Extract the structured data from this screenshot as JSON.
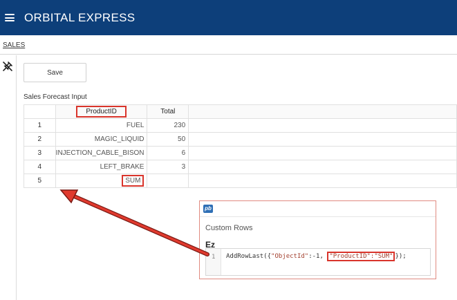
{
  "header": {
    "title": "ORBITAL EXPRESS"
  },
  "tabs": {
    "active": "SALES"
  },
  "toolbar": {
    "save_label": "Save"
  },
  "section": {
    "title": "Sales Forecast Input"
  },
  "grid": {
    "columns": [
      "ProductID",
      "Total"
    ],
    "rows": [
      {
        "num": "1",
        "product": "FUEL",
        "total": "230"
      },
      {
        "num": "2",
        "product": "MAGIC_LIQUID",
        "total": "50"
      },
      {
        "num": "3",
        "product": "INJECTION_CABLE_BISON",
        "total": "6"
      },
      {
        "num": "4",
        "product": "LEFT_BRAKE",
        "total": "3"
      },
      {
        "num": "5",
        "product": "SUM",
        "total": ""
      }
    ]
  },
  "code_panel": {
    "logo": "pb",
    "title": "Custom Rows",
    "editor_icon": "Ez",
    "line_number": "1",
    "code_prefix": "AddRowLast({",
    "code_key1": "\"ObjectId\"",
    "code_mid": ":-1, ",
    "code_highlight": "\"ProductID\":\"SUM\"",
    "code_suffix": "});"
  },
  "colors": {
    "header_bg": "#0d3f7a",
    "highlight": "#d9342b"
  }
}
